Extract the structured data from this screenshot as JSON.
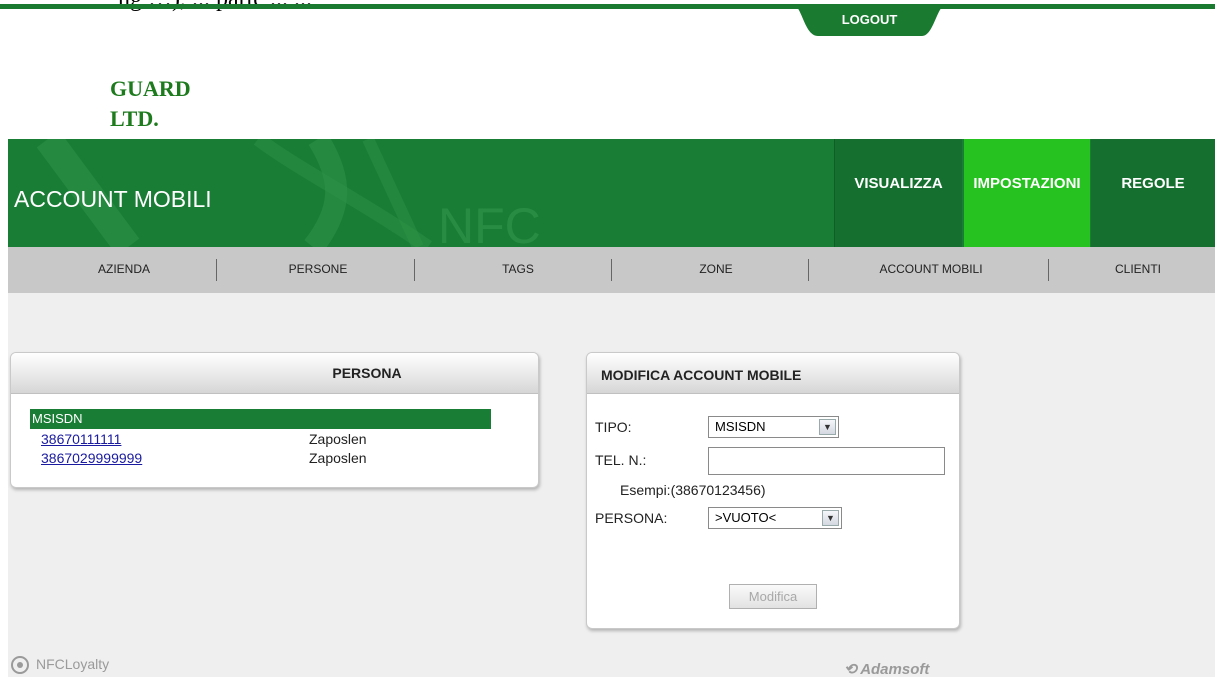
{
  "top_text": "ng …), ... parte ... ...",
  "logout_label": "LOGOUT",
  "logo": {
    "line1": "GUARD",
    "line2": "LTD."
  },
  "header": {
    "title": "ACCOUNT MOBILI",
    "watermark": "NFC"
  },
  "nav": [
    {
      "label": "VISUALIZZA"
    },
    {
      "label": "IMPOSTAZIONI",
      "active": true
    },
    {
      "label": "REGOLE"
    }
  ],
  "subnav": [
    "AZIENDA",
    "PERSONE",
    "TAGS",
    "ZONE",
    "ACCOUNT MOBILI",
    "CLIENTI"
  ],
  "persona_panel": {
    "title": "PERSONA",
    "group": "MSISDN",
    "rows": [
      {
        "number": "38670111111",
        "status": "Zaposlen"
      },
      {
        "number": "3867029999999",
        "status": "Zaposlen"
      }
    ]
  },
  "modifica_panel": {
    "title": "MODIFICA ACCOUNT MOBILE",
    "tipo_label": "TIPO:",
    "tipo_value": "MSISDN",
    "tel_label": "TEL. N.:",
    "tel_value": "",
    "esempi": "Esempi:(38670123456)",
    "persona_label": "PERSONA:",
    "persona_value": ">VUOTO<",
    "button": "Modifica"
  },
  "footer": {
    "left": "NFCLoyalty",
    "right": "Adamsoft"
  },
  "colors": {
    "green": "#1a7d36",
    "active_green": "#26c21f",
    "subnav_gray": "#c8c8c8"
  }
}
